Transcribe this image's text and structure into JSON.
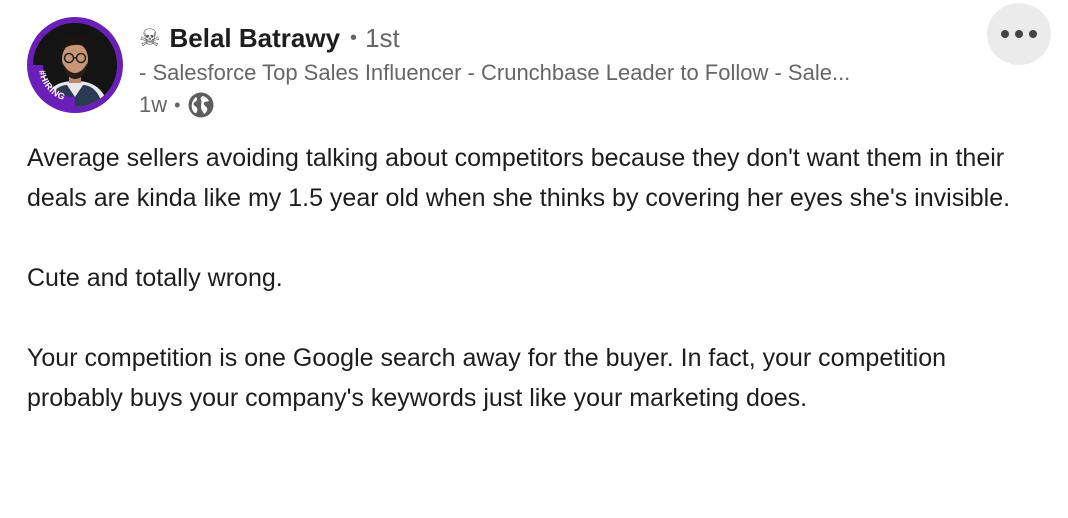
{
  "post": {
    "author": {
      "badge_icon": "skull-crossbones-icon",
      "name": "Belal Batrawy",
      "separator": "•",
      "connection_degree": "1st",
      "headline": "- Salesforce Top Sales Influencer - Crunchbase Leader to Follow - Sale...",
      "avatar_frame_text": "#HIRING",
      "avatar_frame_color": "#6a1fb8"
    },
    "meta": {
      "timestamp": "1w",
      "separator": "•",
      "visibility_icon": "globe-icon"
    },
    "more_button_icon": "ellipsis-icon",
    "paragraphs": [
      "Average sellers avoiding talking about competitors because they don't want them in their deals are kinda like my 1.5 year old when she thinks by covering her eyes she's invisible.",
      "Cute and totally wrong.",
      "Your competition is one Google search away for the buyer. In fact, your competition probably buys your company's keywords just like your marketing does."
    ]
  }
}
